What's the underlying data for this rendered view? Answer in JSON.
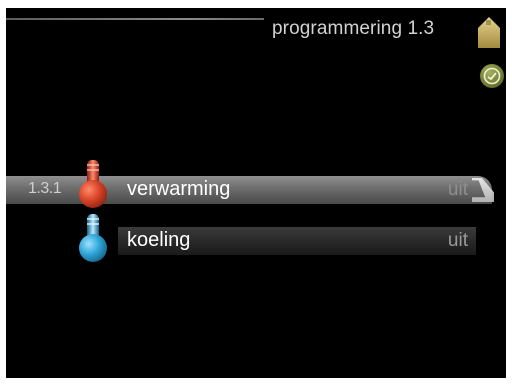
{
  "header": {
    "title": "programmering 1.3"
  },
  "menu": {
    "items": [
      {
        "code": "1.3.1",
        "label": "verwarming",
        "value": "uit",
        "selected": true,
        "icon": "red-thermometer-icon"
      },
      {
        "code": "",
        "label": "koeling",
        "value": "uit",
        "selected": false,
        "icon": "blue-thermometer-icon"
      }
    ]
  },
  "colors": {
    "background": "#000000",
    "heating": "#d9452a",
    "cooling": "#2fa7d8",
    "home_icon": "#c8b06a",
    "clock_icon": "#7e8a3a"
  }
}
